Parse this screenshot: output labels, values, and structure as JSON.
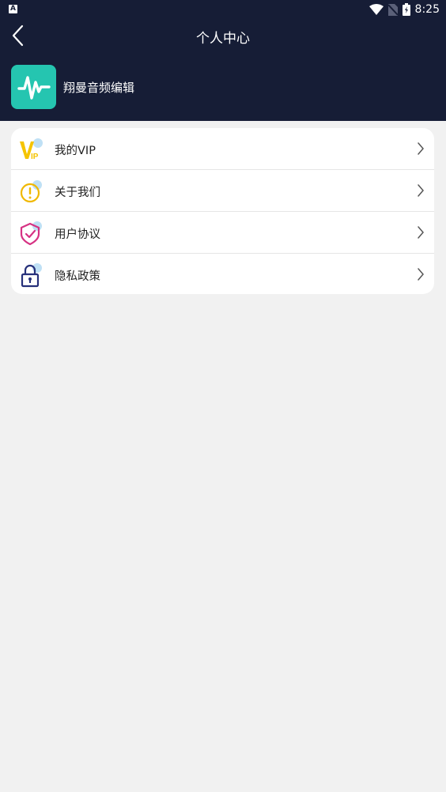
{
  "status_bar": {
    "time": "8:25",
    "left_icon": "A"
  },
  "header": {
    "title": "个人中心",
    "back_icon": "back-arrow-icon"
  },
  "profile": {
    "app_name": "翔曼音频编辑",
    "logo_icon": "waveform-icon"
  },
  "menu": {
    "items": [
      {
        "label": "我的VIP",
        "icon": "vip-icon"
      },
      {
        "label": "关于我们",
        "icon": "info-exclamation-icon"
      },
      {
        "label": "用户协议",
        "icon": "shield-check-icon"
      },
      {
        "label": "隐私政策",
        "icon": "lock-icon"
      }
    ]
  },
  "colors": {
    "header_bg": "#161d36",
    "page_bg": "#f1f1f1",
    "logo_bg": "#25c5b0",
    "vip_yellow": "#f5c400",
    "info_yellow": "#f0b800",
    "shield_pink": "#d63384",
    "lock_navy": "#26307a",
    "accent_light_blue": "#bfe0f5"
  }
}
